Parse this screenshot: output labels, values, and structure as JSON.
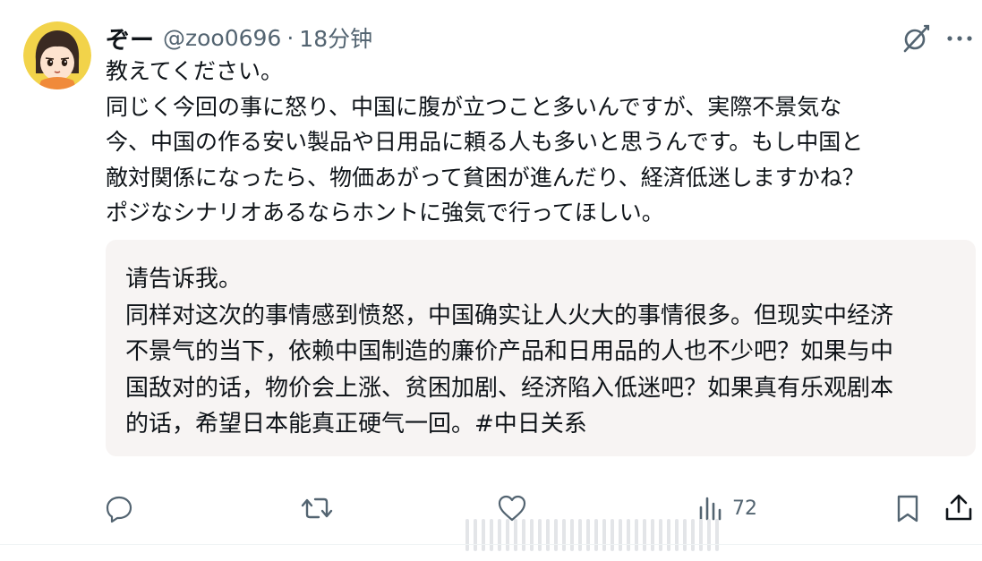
{
  "author": {
    "display_name": "ぞー",
    "handle": "@zoo0696",
    "separator": "·",
    "time": "18分钟"
  },
  "icons": {
    "avatar": "cartoon-girl-avatar",
    "grok": "grok-icon",
    "more": "more-icon",
    "reply": "reply-icon",
    "repost": "repost-icon",
    "like": "heart-icon",
    "views": "views-icon",
    "bookmark": "bookmark-icon",
    "share": "share-icon"
  },
  "post": {
    "lines": [
      "教えてください。",
      "同じく今回の事に怒り、中国に腹が立つこと多いんですが、実際不景気な",
      "今、中国の作る安い製品や日用品に頼る人も多いと思うんです。もし中国と",
      "敵対関係になったら、物価あがって貧困が進んだり、経済低迷しますかね？",
      "ポジなシナリオあるならホントに強気で行ってほしい。"
    ]
  },
  "translation": {
    "lines": [
      "请告诉我。",
      "同样对这次的事情感到愤怒，中国确实让人火大的事情很多。但现实中经济",
      "不景气的当下，依赖中国制造的廉价产品和日用品的人也不少吧？如果与中",
      "国敌对的话，物价会上涨、贫困加剧、经济陷入低迷吧？如果真有乐观剧本",
      "的话，希望日本能真正硬气一回。#中日关系"
    ]
  },
  "actions": {
    "views_count": "72"
  },
  "colors": {
    "text": "#0f1419",
    "secondary": "#536471",
    "translation_bg": "#f7f4f3"
  }
}
